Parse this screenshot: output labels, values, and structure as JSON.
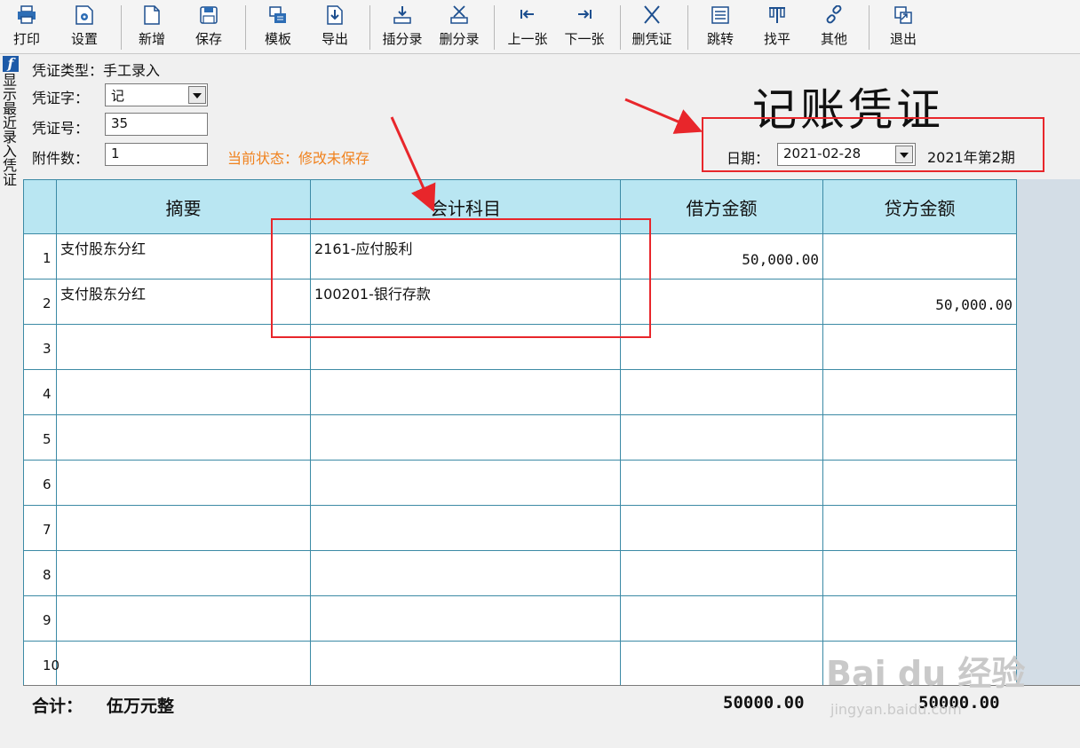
{
  "toolbar": {
    "buttons": [
      {
        "label": "打印",
        "icon": "printer-icon"
      },
      {
        "label": "设置",
        "icon": "settings-icon"
      },
      {
        "label": "新增",
        "icon": "new-document-icon"
      },
      {
        "label": "保存",
        "icon": "save-icon"
      },
      {
        "label": "模板",
        "icon": "template-icon"
      },
      {
        "label": "导出",
        "icon": "export-icon"
      },
      {
        "label": "插分录",
        "icon": "insert-row-icon"
      },
      {
        "label": "删分录",
        "icon": "delete-row-icon"
      },
      {
        "label": "上一张",
        "icon": "prev-icon"
      },
      {
        "label": "下一张",
        "icon": "next-icon"
      },
      {
        "label": "删凭证",
        "icon": "delete-voucher-icon"
      },
      {
        "label": "跳转",
        "icon": "jump-icon"
      },
      {
        "label": "找平",
        "icon": "balance-icon"
      },
      {
        "label": "其他",
        "icon": "link-icon"
      },
      {
        "label": "退出",
        "icon": "exit-icon"
      }
    ]
  },
  "sidebar": {
    "f_label": "f",
    "vertical_text": "显示最近录入凭证"
  },
  "voucher": {
    "type_label": "凭证类型：",
    "type_value": "手工录入",
    "word_label": "凭证字：",
    "word_value": "记",
    "number_label": "凭证号：",
    "number_value": "35",
    "attach_label": "附件数：",
    "attach_value": "1",
    "status_text": "当前状态：修改未保存",
    "title": "记账凭证",
    "date_label": "日期：",
    "date_value": "2021-02-28",
    "period_text": "2021年第2期"
  },
  "table": {
    "headers": [
      "摘要",
      "会计科目",
      "借方金额",
      "贷方金额"
    ],
    "rows": [
      {
        "num": "1",
        "summary": "支付股东分红",
        "account": "2161-应付股利",
        "debit": "50,000.00",
        "credit": ""
      },
      {
        "num": "2",
        "summary": "支付股东分红",
        "account": "100201-银行存款",
        "debit": "",
        "credit": "50,000.00"
      },
      {
        "num": "3",
        "summary": "",
        "account": "",
        "debit": "",
        "credit": ""
      },
      {
        "num": "4",
        "summary": "",
        "account": "",
        "debit": "",
        "credit": ""
      },
      {
        "num": "5",
        "summary": "",
        "account": "",
        "debit": "",
        "credit": ""
      },
      {
        "num": "6",
        "summary": "",
        "account": "",
        "debit": "",
        "credit": ""
      },
      {
        "num": "7",
        "summary": "",
        "account": "",
        "debit": "",
        "credit": ""
      },
      {
        "num": "8",
        "summary": "",
        "account": "",
        "debit": "",
        "credit": ""
      },
      {
        "num": "9",
        "summary": "",
        "account": "",
        "debit": "",
        "credit": ""
      },
      {
        "num": "10",
        "summary": "",
        "account": "",
        "debit": "",
        "credit": ""
      }
    ]
  },
  "totals": {
    "label": "合计：",
    "words": "伍万元整",
    "debit_total": "50000.00",
    "credit_total": "50000.00"
  },
  "watermark": {
    "brand": "Bai du 经验",
    "url": "jingyan.baidu.com"
  },
  "colors": {
    "header_bg": "#b9e6f2",
    "grid_line": "#3c8aa5",
    "annotation": "#e8262b",
    "status": "#f0821e"
  }
}
